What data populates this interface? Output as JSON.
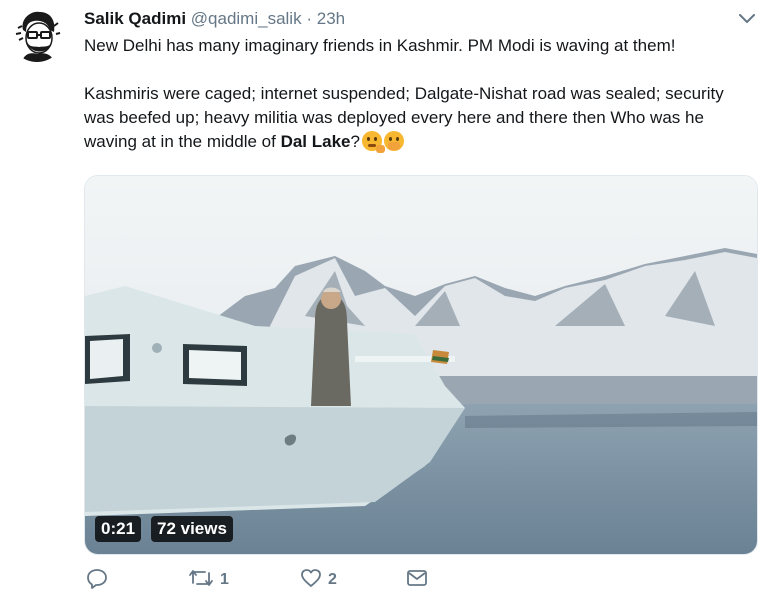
{
  "tweet": {
    "display_name": "Salik Qadimi",
    "handle": "@qadimi_salik",
    "separator": "·",
    "time": "23h",
    "text_line1": "New Delhi has many imaginary friends in Kashmir. PM Modi is waving at them!",
    "text_para2_before": "Kashmiris were caged; internet suspended; Dalgate-Nishat road was sealed; security was beefed up; heavy militia was deployed every here and there then Who was he waving at in the middle of ",
    "text_para2_bold": "Dal Lake",
    "text_para2_after": "?",
    "emojis": [
      "thinking-face",
      "face-with-hand-over-mouth"
    ]
  },
  "video": {
    "duration": "0:21",
    "views": "72 views"
  },
  "actions": {
    "reply_count": "",
    "retweet_count": "1",
    "like_count": "2"
  },
  "colors": {
    "text": "#14171a",
    "secondary": "#657786",
    "boat": "#dde7ea",
    "lake": "#7d93a4",
    "sky": "#e9eef1"
  }
}
